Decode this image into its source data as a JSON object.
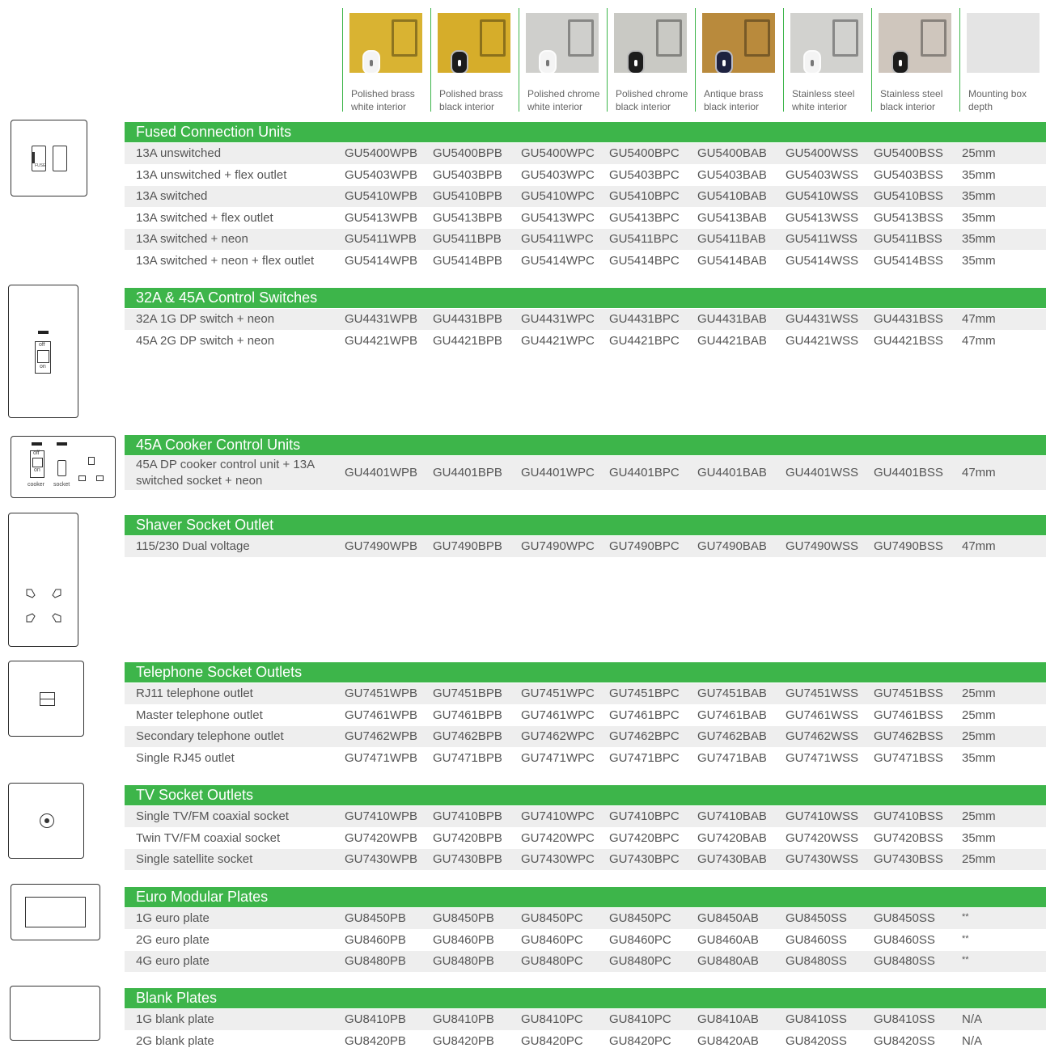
{
  "columns": [
    {
      "label": "Polished brass\nwhite interior",
      "icon": "brass-white-swatch",
      "bg": "#d9b332",
      "hole": "#f4f4f4"
    },
    {
      "label": "Polished brass\nblack interior",
      "icon": "brass-black-swatch",
      "bg": "#d6ad2a",
      "hole": "#1c1c1c"
    },
    {
      "label": "Polished chrome\nwhite interior",
      "icon": "chrome-white-swatch",
      "bg": "#cfcfcc",
      "hole": "#f4f4f4"
    },
    {
      "label": "Polished chrome\nblack interior",
      "icon": "chrome-black-swatch",
      "bg": "#c9c9c4",
      "hole": "#1c1c1c"
    },
    {
      "label": "Antique brass\nblack interior",
      "icon": "antique-brass-swatch",
      "bg": "#b98a3c",
      "hole": "#1e2240"
    },
    {
      "label": "Stainless steel\nwhite interior",
      "icon": "steel-white-swatch",
      "bg": "#d2d2cf",
      "hole": "#f4f4f4"
    },
    {
      "label": "Stainless steel\nblack interior",
      "icon": "steel-black-swatch",
      "bg": "#cfc6bd",
      "hole": "#1c1c1c"
    },
    {
      "label": "Mounting box\ndepth",
      "icon": "blank-swatch",
      "bg": "#e4e4e4",
      "hole": ""
    }
  ],
  "sections": [
    {
      "title": "Fused Connection Units",
      "icon": "fused-connection-unit-icon",
      "rows": [
        {
          "desc": "13A unswitched",
          "codes": [
            "GU5400WPB",
            "GU5400BPB",
            "GU5400WPC",
            "GU5400BPC",
            "GU5400BAB",
            "GU5400WSS",
            "GU5400BSS"
          ],
          "depth": "25mm"
        },
        {
          "desc": "13A unswitched + flex outlet",
          "codes": [
            "GU5403WPB",
            "GU5403BPB",
            "GU5403WPC",
            "GU5403BPC",
            "GU5403BAB",
            "GU5403WSS",
            "GU5403BSS"
          ],
          "depth": "35mm"
        },
        {
          "desc": "13A switched",
          "codes": [
            "GU5410WPB",
            "GU5410BPB",
            "GU5410WPC",
            "GU5410BPC",
            "GU5410BAB",
            "GU5410WSS",
            "GU5410BSS"
          ],
          "depth": "35mm"
        },
        {
          "desc": "13A switched + flex outlet",
          "codes": [
            "GU5413WPB",
            "GU5413BPB",
            "GU5413WPC",
            "GU5413BPC",
            "GU5413BAB",
            "GU5413WSS",
            "GU5413BSS"
          ],
          "depth": "35mm"
        },
        {
          "desc": "13A switched + neon",
          "codes": [
            "GU5411WPB",
            "GU5411BPB",
            "GU5411WPC",
            "GU5411BPC",
            "GU5411BAB",
            "GU5411WSS",
            "GU5411BSS"
          ],
          "depth": "35mm"
        },
        {
          "desc": "13A switched + neon + flex outlet",
          "codes": [
            "GU5414WPB",
            "GU5414BPB",
            "GU5414WPC",
            "GU5414BPC",
            "GU5414BAB",
            "GU5414WSS",
            "GU5414BSS"
          ],
          "depth": "35mm"
        }
      ]
    },
    {
      "title": "32A & 45A Control Switches",
      "icon": "control-switch-icon",
      "rows": [
        {
          "desc": "32A 1G DP switch + neon",
          "codes": [
            "GU4431WPB",
            "GU4431BPB",
            "GU4431WPC",
            "GU4431BPC",
            "GU4431BAB",
            "GU4431WSS",
            "GU4431BSS"
          ],
          "depth": "47mm"
        },
        {
          "desc": "45A 2G DP switch + neon",
          "codes": [
            "GU4421WPB",
            "GU4421BPB",
            "GU4421WPC",
            "GU4421BPC",
            "GU4421BAB",
            "GU4421WSS",
            "GU4421BSS"
          ],
          "depth": "47mm"
        }
      ]
    },
    {
      "title": "45A Cooker Control Units",
      "icon": "cooker-control-unit-icon",
      "rows": [
        {
          "desc": "45A DP cooker control unit + 13A\nswitched socket + neon",
          "codes": [
            "GU4401WPB",
            "GU4401BPB",
            "GU4401WPC",
            "GU4401BPC",
            "GU4401BAB",
            "GU4401WSS",
            "GU4401BSS"
          ],
          "depth": "47mm"
        }
      ]
    },
    {
      "title": "Shaver Socket Outlet",
      "icon": "shaver-socket-icon",
      "rows": [
        {
          "desc": "115/230 Dual voltage",
          "codes": [
            "GU7490WPB",
            "GU7490BPB",
            "GU7490WPC",
            "GU7490BPC",
            "GU7490BAB",
            "GU7490WSS",
            "GU7490BSS"
          ],
          "depth": "47mm"
        }
      ]
    },
    {
      "title": "Telephone Socket Outlets",
      "icon": "telephone-socket-icon",
      "rows": [
        {
          "desc": "RJ11 telephone outlet",
          "codes": [
            "GU7451WPB",
            "GU7451BPB",
            "GU7451WPC",
            "GU7451BPC",
            "GU7451BAB",
            "GU7451WSS",
            "GU7451BSS"
          ],
          "depth": "25mm"
        },
        {
          "desc": "Master telephone outlet",
          "codes": [
            "GU7461WPB",
            "GU7461BPB",
            "GU7461WPC",
            "GU7461BPC",
            "GU7461BAB",
            "GU7461WSS",
            "GU7461BSS"
          ],
          "depth": "25mm"
        },
        {
          "desc": "Secondary telephone outlet",
          "codes": [
            "GU7462WPB",
            "GU7462BPB",
            "GU7462WPC",
            "GU7462BPC",
            "GU7462BAB",
            "GU7462WSS",
            "GU7462BSS"
          ],
          "depth": "25mm"
        },
        {
          "desc": "Single RJ45 outlet",
          "codes": [
            "GU7471WPB",
            "GU7471BPB",
            "GU7471WPC",
            "GU7471BPC",
            "GU7471BAB",
            "GU7471WSS",
            "GU7471BSS"
          ],
          "depth": "35mm"
        }
      ]
    },
    {
      "title": "TV Socket Outlets",
      "icon": "tv-socket-icon",
      "rows": [
        {
          "desc": "Single TV/FM coaxial socket",
          "codes": [
            "GU7410WPB",
            "GU7410BPB",
            "GU7410WPC",
            "GU7410BPC",
            "GU7410BAB",
            "GU7410WSS",
            "GU7410BSS"
          ],
          "depth": "25mm"
        },
        {
          "desc": "Twin TV/FM coaxial socket",
          "codes": [
            "GU7420WPB",
            "GU7420BPB",
            "GU7420WPC",
            "GU7420BPC",
            "GU7420BAB",
            "GU7420WSS",
            "GU7420BSS"
          ],
          "depth": "35mm"
        },
        {
          "desc": "Single satellite socket",
          "codes": [
            "GU7430WPB",
            "GU7430BPB",
            "GU7430WPC",
            "GU7430BPC",
            "GU7430BAB",
            "GU7430WSS",
            "GU7430BSS"
          ],
          "depth": "25mm"
        }
      ]
    },
    {
      "title": "Euro Modular Plates",
      "icon": "euro-modular-plate-icon",
      "rows": [
        {
          "desc": "1G euro plate",
          "codes": [
            "GU8450PB",
            "GU8450PB",
            "GU8450PC",
            "GU8450PC",
            "GU8450AB",
            "GU8450SS",
            "GU8450SS"
          ],
          "depth": "**"
        },
        {
          "desc": "2G euro plate",
          "codes": [
            "GU8460PB",
            "GU8460PB",
            "GU8460PC",
            "GU8460PC",
            "GU8460AB",
            "GU8460SS",
            "GU8460SS"
          ],
          "depth": "**"
        },
        {
          "desc": "4G euro plate",
          "codes": [
            "GU8480PB",
            "GU8480PB",
            "GU8480PC",
            "GU8480PC",
            "GU8480AB",
            "GU8480SS",
            "GU8480SS"
          ],
          "depth": "**"
        }
      ]
    },
    {
      "title": "Blank Plates",
      "icon": "blank-plate-icon",
      "rows": [
        {
          "desc": "1G blank plate",
          "codes": [
            "GU8410PB",
            "GU8410PB",
            "GU8410PC",
            "GU8410PC",
            "GU8410AB",
            "GU8410SS",
            "GU8410SS"
          ],
          "depth": "N/A"
        },
        {
          "desc": "2G blank plate",
          "codes": [
            "GU8420PB",
            "GU8420PB",
            "GU8420PC",
            "GU8420PC",
            "GU8420AB",
            "GU8420SS",
            "GU8420SS"
          ],
          "depth": "N/A"
        }
      ]
    }
  ],
  "icon_labels": {
    "fuse": "FUSE",
    "off": "off",
    "on": "on",
    "cooker": "cooker",
    "socket": "socket"
  },
  "colors": {
    "accent": "#3db54a",
    "row_shade": "#eeeeee"
  }
}
